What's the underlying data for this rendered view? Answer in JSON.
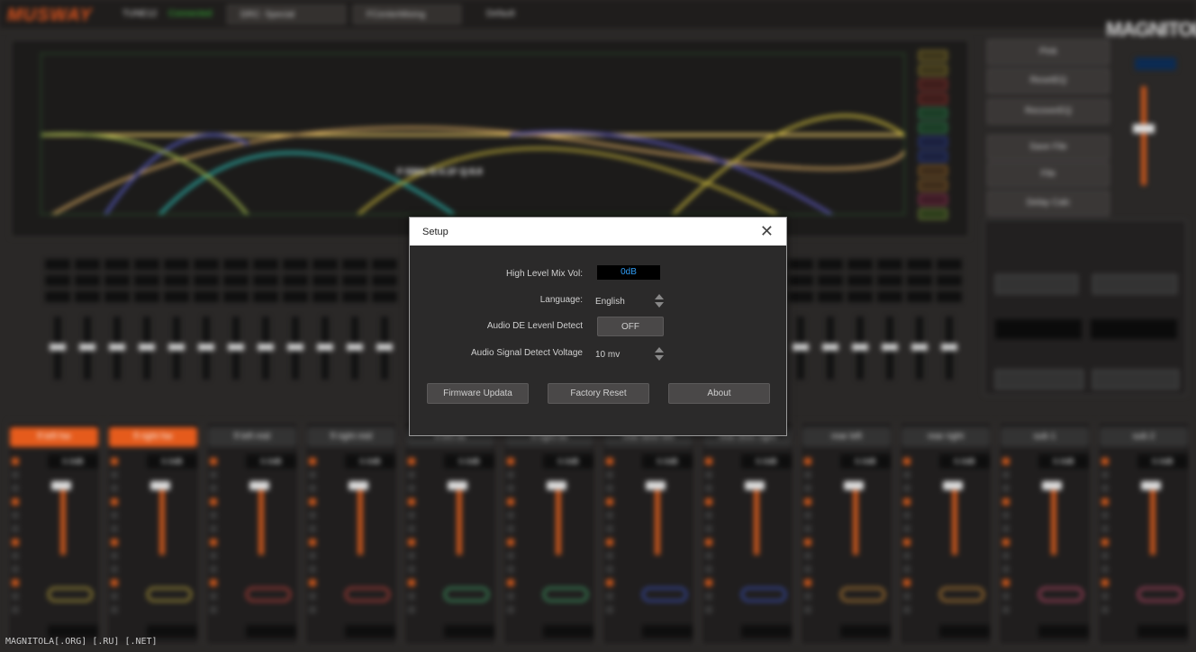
{
  "app": {
    "brand": "MUSWAY",
    "model": "TUNE12",
    "status": "Connected",
    "preset_select": "DRC: Special",
    "mode_select": "FCenterMixing",
    "default_button": "Default",
    "watermark": "MAGNITOLA",
    "footer": "MAGNITOLA[.ORG] [.RU] [.NET]",
    "side_buttons": [
      "Pink",
      "ResetEQ",
      "RecoverEQ",
      "Save File",
      "File",
      "Delay Calc"
    ],
    "eq_annotation": "F:50Hz G:4.1F Q:8.8",
    "channels": [
      {
        "label": "fl left hw",
        "value": "0.0dB",
        "active": true,
        "ring": "#b8a23a"
      },
      {
        "label": "fl right hw",
        "value": "0.0dB",
        "active": true,
        "ring": "#b8a23a"
      },
      {
        "label": "fl left mid",
        "value": "0.0dB",
        "active": false,
        "ring": "#c0413a"
      },
      {
        "label": "fl right mid",
        "value": "0.0dB",
        "active": false,
        "ring": "#c0413a"
      },
      {
        "label": "fl left tw",
        "value": "0.0dB",
        "active": false,
        "ring": "#3fa267"
      },
      {
        "label": "fl right tw",
        "value": "0.0dB",
        "active": false,
        "ring": "#3fa267"
      },
      {
        "label": "rear door left",
        "value": "0.0dB",
        "active": false,
        "ring": "#3a53c0"
      },
      {
        "label": "rear door right",
        "value": "0.0dB",
        "active": false,
        "ring": "#3a53c0"
      },
      {
        "label": "rear left",
        "value": "0.0dB",
        "active": false,
        "ring": "#c98a34"
      },
      {
        "label": "rear right",
        "value": "0.0dB",
        "active": false,
        "ring": "#c98a34"
      },
      {
        "label": "sub 1",
        "value": "0.0dB",
        "active": false,
        "ring": "#c04a6a"
      },
      {
        "label": "sub 2",
        "value": "0.0dB",
        "active": false,
        "ring": "#c04a6a"
      }
    ]
  },
  "setup_dialog": {
    "title": "Setup",
    "close_symbol": "✕",
    "high_level_mix_vol": {
      "label": "High Level Mix Vol:",
      "value": "0dB"
    },
    "language": {
      "label": "Language:",
      "value": "English"
    },
    "audio_de_level_detect": {
      "label": "Audio DE Levenl Detect",
      "value": "OFF"
    },
    "audio_signal_detect_voltage": {
      "label": "Audio Signal Detect Voltage",
      "value": "10 mv"
    },
    "buttons": {
      "firmware_update": "Firmware Updata",
      "factory_reset": "Factory Reset",
      "about": "About"
    }
  },
  "colors": {
    "accent_orange": "#e55b1c",
    "value_blue": "#2f9cf4",
    "dialog_bg": "#2b2a2a"
  }
}
